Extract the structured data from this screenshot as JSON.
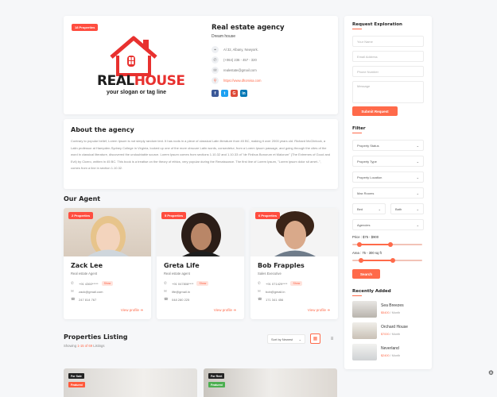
{
  "agency": {
    "badge": "18 Properties",
    "logo_text_1": "REAL",
    "logo_text_2": "HOUSE",
    "logo_slogan": "your slogan or tag line",
    "name": "Real estate agency",
    "tagline": "Dream house",
    "address": "Al 32, Albany, Newyork.",
    "phone": "(+064) 236 - 457 - 320",
    "email": "realestate@gmail.com",
    "website": "https://www.dhomisa.com",
    "social": [
      {
        "name": "facebook-icon",
        "glyph": "f",
        "color": "#3b5998"
      },
      {
        "name": "twitter-icon",
        "glyph": "t",
        "color": "#1da1f2"
      },
      {
        "name": "google-icon",
        "glyph": "G",
        "color": "#dd4b39"
      },
      {
        "name": "linkedin-icon",
        "glyph": "in",
        "color": "#0077b5"
      }
    ]
  },
  "about": {
    "title": "About the agency",
    "text": "Contrary to popular belief, Lorem Ipsum is not simply random text. It has roots in a piece of classical Latin literature from 45 BC, making it over 2000 years old. Richard McClintock, a Latin professor at Hampden-Sydney College in Virginia, looked up one of the more obscure Latin words, consectetur, from a Lorem Ipsum passage, and going through the cites of the word in classical literature, discovered the undoubtable source. Lorem Ipsum comes from sections 1.10.32 and 1.10.33 of \"de Finibus Bonorum et Malorum\" (The Extremes of Good and Evil) by Cicero, written in 45 BC. This book is a treatise on the theory of ethics, very popular during the Renaissance. The first line of Lorem Ipsum, \"Lorem ipsum dolor sit amet..\", comes from a line in section 1.10.32."
  },
  "agents_heading": "Our Agent",
  "agents": [
    {
      "badge": "2 Properties",
      "name": "Zack Lee",
      "role": "Real estate Agent",
      "phone": "+91 4360*****",
      "show": "Show",
      "email": "zack@gmail.com",
      "fax": "247 814 767",
      "view": "View profile"
    },
    {
      "badge": "5 Properties",
      "name": "Greta Life",
      "role": "Real estate agent",
      "phone": "+91 047808****",
      "show": "Show",
      "email": "life@gmail.in",
      "fax": "048 280 225",
      "view": "View profile"
    },
    {
      "badge": "6 Properties",
      "name": "Bob Frapples",
      "role": "Sales Executive",
      "phone": "+91 071429****",
      "show": "Show",
      "email": "bob@gmail.in",
      "fax": "171 341 456",
      "view": "View profile"
    }
  ],
  "properties": {
    "heading": "Properties Listing",
    "count_prefix": "Showing ",
    "count_range": "1-15 of 69",
    "count_suffix": " Listings",
    "sort_label": "Sort by Newest",
    "cards": [
      {
        "tag1": "For Sale",
        "tag2": "Featured"
      },
      {
        "tag1": "For Rent",
        "tag2": "Featured"
      }
    ]
  },
  "sidebar": {
    "request_title": "Request Exploration",
    "your_name": "Your Name",
    "email": "Email Address",
    "phone": "Phone Number",
    "message": "Message",
    "submit": "Submit Request",
    "filter_title": "Filter",
    "property_status": "Property Status",
    "property_type": "Property Type",
    "property_location": "Property Location",
    "max_rooms": "Max Rooms",
    "bed": "Bed",
    "bath": "Bath",
    "agencies": "Agencies",
    "price_label": "Price : $75 - $900",
    "price_range": [
      0.1,
      0.55
    ],
    "area_label": "Area : 75 - 300 sq ft",
    "area_range": [
      0.12,
      0.58
    ],
    "search": "Search",
    "recent_title": "Recently Added",
    "recent": [
      {
        "name": "Sea Breezes",
        "price": "$5400",
        "period": " / Month"
      },
      {
        "name": "Orchard House",
        "price": "$7000",
        "period": " / Month"
      },
      {
        "name": "Neverland",
        "price": "$2400",
        "period": " / Month"
      }
    ]
  }
}
